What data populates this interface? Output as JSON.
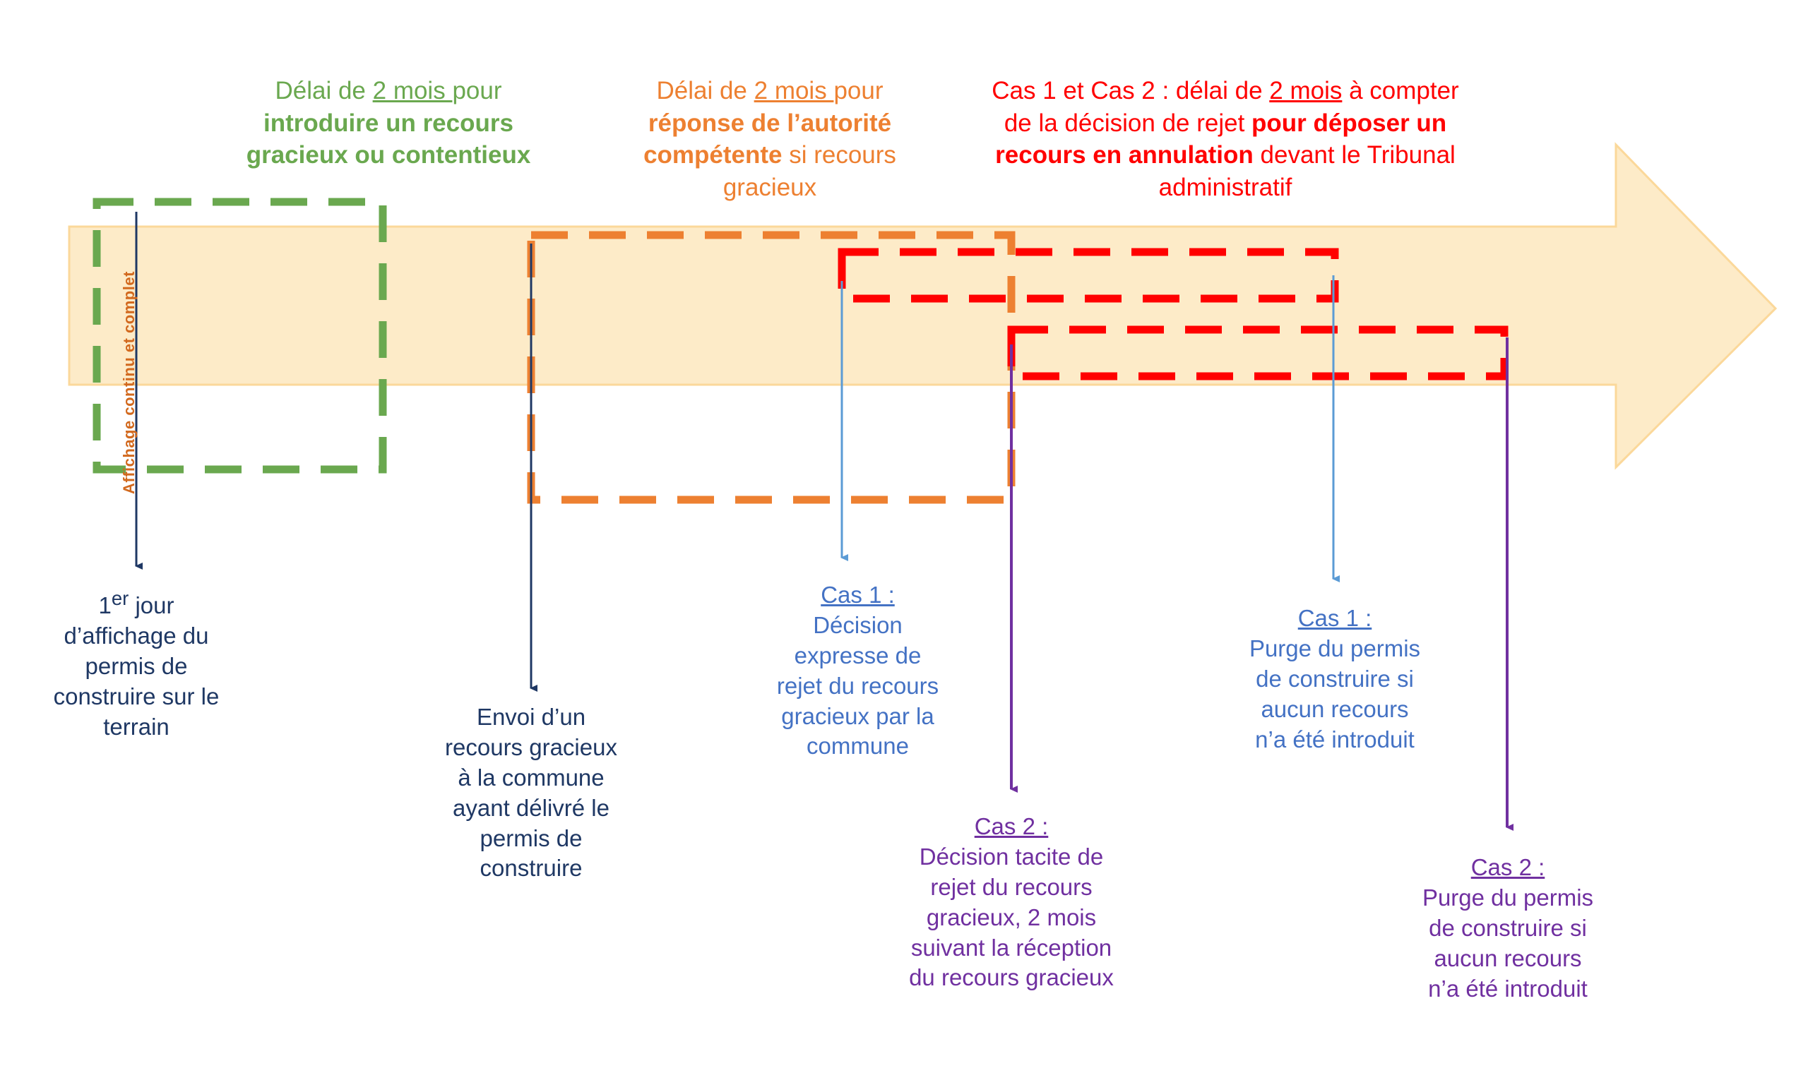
{
  "diagram": {
    "title_vertical_label": "Affichage continu  et complet",
    "banner": {
      "fill": "#FDEBC8",
      "stroke": "#FBD89A",
      "shape": "right-arrow"
    },
    "annotations": [
      {
        "id": "green",
        "color": "#6AA84F",
        "lines": [
          [
            {
              "t": "Délai de ",
              "s": "n"
            },
            {
              "t": "2 mois ",
              "s": "u"
            },
            {
              "t": "pour",
              "s": "n"
            }
          ],
          [
            {
              "t": "introduire un recours",
              "s": "b"
            }
          ],
          [
            {
              "t": "gracieux ou contentieux",
              "s": "b"
            }
          ]
        ],
        "plain": "Délai de 2 mois pour introduire un recours gracieux ou contentieux"
      },
      {
        "id": "orange",
        "color": "#ED8031",
        "lines": [
          [
            {
              "t": "Délai de ",
              "s": "n"
            },
            {
              "t": "2 mois ",
              "s": "u"
            },
            {
              "t": "pour",
              "s": "n"
            }
          ],
          [
            {
              "t": "réponse de l’autorité",
              "s": "b"
            }
          ],
          [
            {
              "t": "compétente",
              "s": "b"
            },
            {
              "t": " si recours",
              "s": "n"
            }
          ],
          [
            {
              "t": "gracieux",
              "s": "n"
            }
          ]
        ],
        "plain": "Délai de 2 mois pour réponse de l’autorité compétente si recours gracieux"
      },
      {
        "id": "red",
        "color": "#FF0000",
        "lines": [
          [
            {
              "t": "Cas 1 et Cas 2 : délai de ",
              "s": "n"
            },
            {
              "t": "2 mois",
              "s": "u"
            },
            {
              "t": " à compter",
              "s": "n"
            }
          ],
          [
            {
              "t": "de la décision de rejet ",
              "s": "n"
            },
            {
              "t": "pour déposer un",
              "s": "b"
            }
          ],
          [
            {
              "t": "recours en annulation",
              "s": "b"
            },
            {
              "t": " devant le Tribunal",
              "s": "n"
            }
          ],
          [
            {
              "t": "administratif",
              "s": "n"
            }
          ]
        ],
        "plain": "Cas 1 et Cas 2 : délai de 2 mois à compter de la décision de rejet pour déposer un recours en annulation devant le Tribunal administratif"
      }
    ],
    "callouts": [
      {
        "id": "premier-jour-affichage",
        "color": "#1F3864",
        "heading": "",
        "lines": [
          "1er jour",
          "d’affichage du",
          "permis de",
          "construire sur le",
          "terrain"
        ],
        "plain": "1er jour d’affichage du permis de construire sur le terrain"
      },
      {
        "id": "envoi-recours-gracieux",
        "color": "#1F3864",
        "heading": "",
        "lines": [
          "Envoi d’un",
          "recours gracieux",
          "à la commune",
          "ayant délivré le",
          "permis de",
          "construire"
        ],
        "plain": "Envoi d’un recours gracieux à la commune ayant délivré le permis de construire"
      },
      {
        "id": "cas-1-decision-expresse",
        "color": "#4472C4",
        "heading": "Cas 1 :",
        "lines": [
          "Décision",
          "expresse de",
          "rejet du recours",
          "gracieux par la",
          "commune"
        ],
        "plain": "Cas 1 : Décision expresse de rejet du recours gracieux par la commune"
      },
      {
        "id": "cas-2-decision-tacite",
        "color": "#7030A0",
        "heading": "Cas 2 :",
        "lines": [
          "Décision tacite de",
          "rejet du recours",
          "gracieux, 2 mois",
          "suivant la réception",
          "du recours gracieux"
        ],
        "plain": "Cas 2 : Décision tacite de rejet du recours gracieux, 2 mois suivant la réception du recours gracieux"
      },
      {
        "id": "cas-1-purge",
        "color": "#4472C4",
        "heading": "Cas 1 :",
        "lines": [
          "Purge du permis",
          "de construire si",
          "aucun recours",
          "n’a été introduit"
        ],
        "plain": "Cas 1 : Purge du permis de construire si aucun recours n’a été introduit"
      },
      {
        "id": "cas-2-purge",
        "color": "#7030A0",
        "heading": "Cas 2 :",
        "lines": [
          "Purge du permis",
          "de construire si",
          "aucun recours",
          "n’a été introduit"
        ],
        "plain": "Cas 2 : Purge du permis de construire si aucun recours n’a été introduit"
      }
    ],
    "period_boxes": [
      {
        "id": "green-period",
        "color": "#6AA84F",
        "label": "Délai de 2 mois pour introduire un recours gracieux ou contentieux"
      },
      {
        "id": "orange-period",
        "color": "#ED8031",
        "label": "Délai de 2 mois pour réponse de l’autorité compétente si recours gracieux"
      },
      {
        "id": "red-period-cas1",
        "color": "#FF0000",
        "label": "Cas 1 : délai de 2 mois pour recours en annulation"
      },
      {
        "id": "red-period-cas2",
        "color": "#FF0000",
        "label": "Cas 2 : délai de 2 mois pour recours en annulation"
      }
    ],
    "connectors": [
      {
        "id": "connector-premier-jour",
        "color": "#1F3864"
      },
      {
        "id": "connector-envoi-recours",
        "color": "#1F3864"
      },
      {
        "id": "connector-cas1-decision",
        "color": "#5B9BD5"
      },
      {
        "id": "connector-cas2-decision",
        "color": "#7030A0"
      },
      {
        "id": "connector-cas1-purge",
        "color": "#5B9BD5"
      },
      {
        "id": "connector-cas2-purge",
        "color": "#7030A0"
      }
    ]
  }
}
